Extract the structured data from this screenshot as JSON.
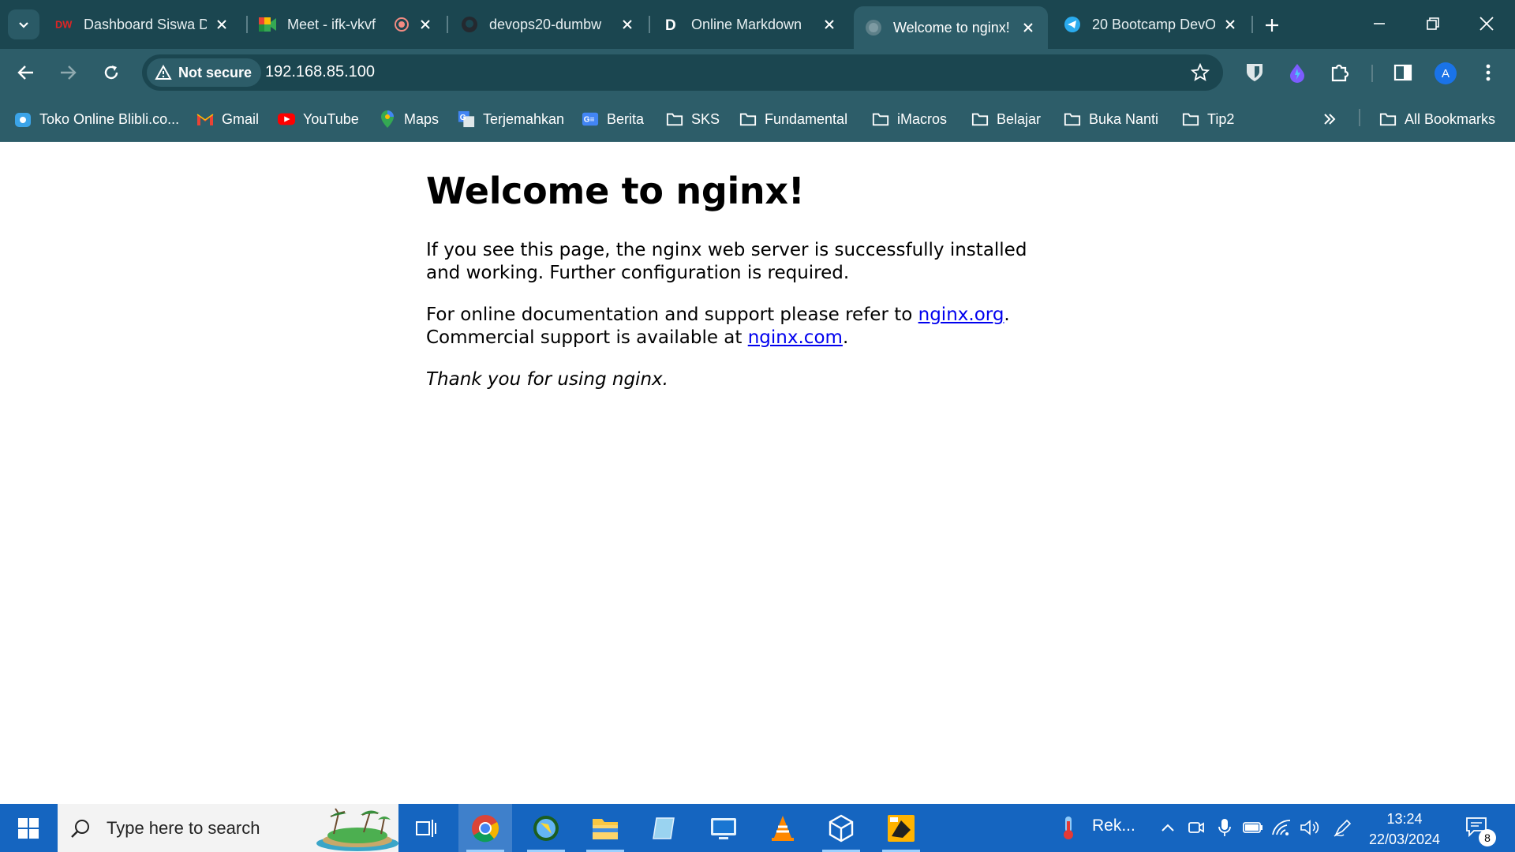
{
  "browser": {
    "tabs": [
      {
        "title": "Dashboard Siswa D",
        "favicon": "dumbways-icon"
      },
      {
        "title": "Meet - ifk-vkvf",
        "favicon": "google-meet-icon"
      },
      {
        "title": "devops20-dumbw",
        "favicon": "github-icon"
      },
      {
        "title": "Online Markdown",
        "favicon": "d-icon"
      },
      {
        "title": "Welcome to nginx!",
        "favicon": "globe-icon",
        "active": true
      },
      {
        "title": "20 Bootcamp DevO",
        "favicon": "telegram-icon"
      }
    ],
    "security_label": "Not secure",
    "url": "192.168.85.100",
    "profile_initial": "A",
    "bookmarks": [
      {
        "label": "Toko Online Blibli.co..."
      },
      {
        "label": "Gmail"
      },
      {
        "label": "YouTube"
      },
      {
        "label": "Maps"
      },
      {
        "label": "Terjemahkan"
      },
      {
        "label": "Berita"
      },
      {
        "label": "SKS"
      },
      {
        "label": "Fundamental"
      },
      {
        "label": "iMacros"
      },
      {
        "label": "Belajar"
      },
      {
        "label": "Buka Nanti"
      },
      {
        "label": "Tip2"
      }
    ],
    "all_bookmarks_label": "All Bookmarks"
  },
  "page": {
    "heading": "Welcome to nginx!",
    "para1": "If you see this page, the nginx web server is successfully installed and working. Further configuration is required.",
    "para2_prefix": "For online documentation and support please refer to ",
    "link1": "nginx.org",
    "para2_mid": ".",
    "para2_line2": "Commercial support is available at ",
    "link2": "nginx.com",
    "para2_suffix": ".",
    "thanks": "Thank you for using nginx."
  },
  "taskbar": {
    "search_placeholder": "Type here to search",
    "tray_app_label": "Rek...",
    "time": "13:24",
    "date": "22/03/2024",
    "notification_count": "8"
  },
  "colors": {
    "chrome_dark": "#1b4650",
    "chrome_light": "#2d5d69",
    "link": "#0000ee",
    "taskbar": "#1565c0"
  }
}
